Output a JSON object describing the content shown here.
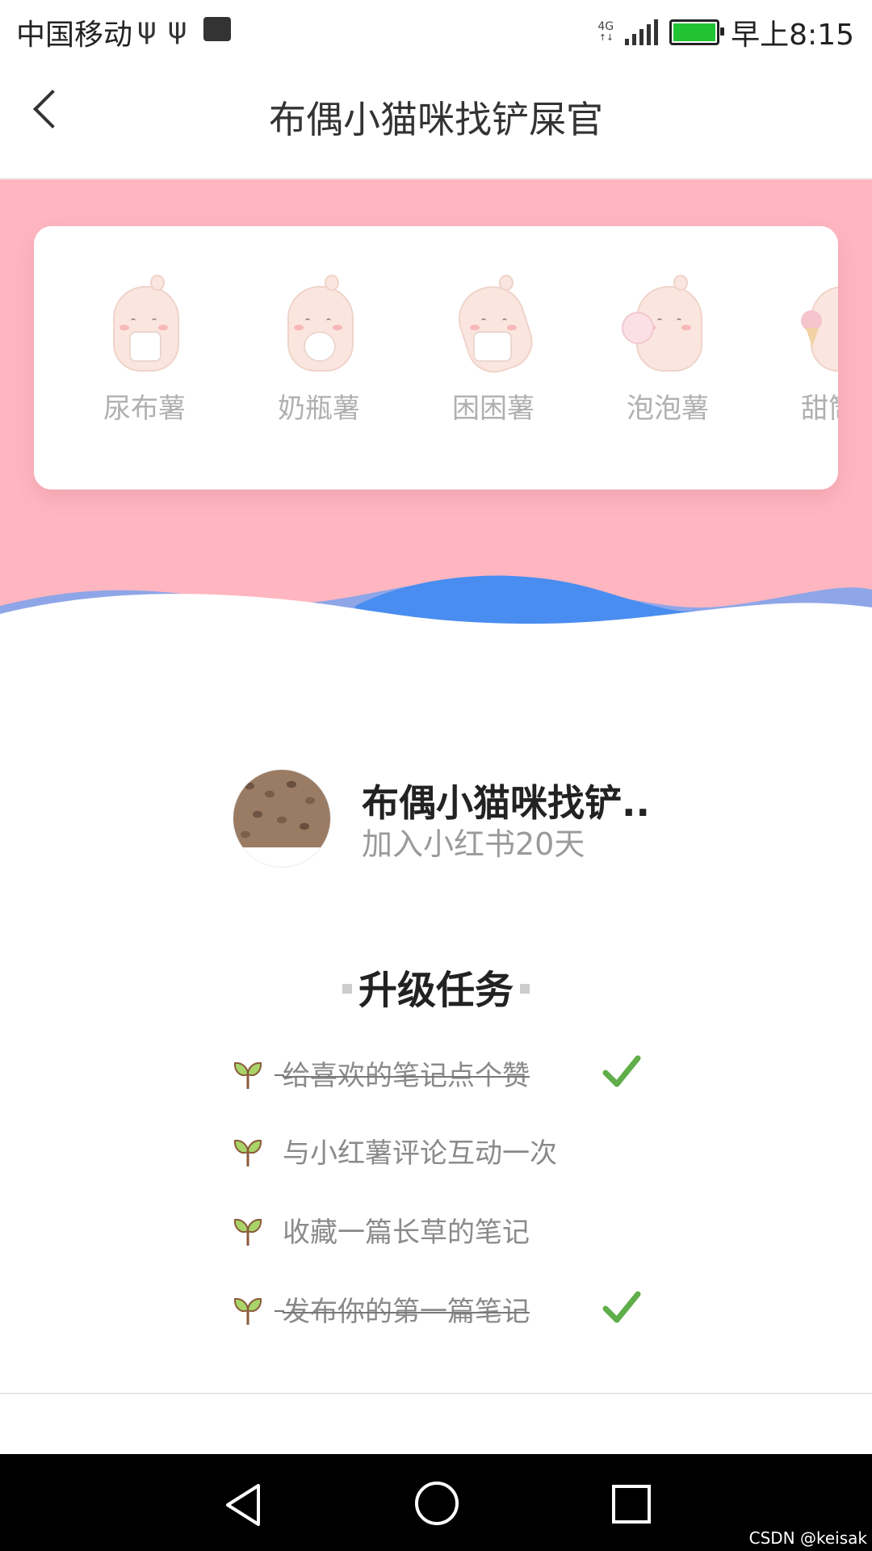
{
  "status_bar": {
    "carrier": "中国移动",
    "usb_icons": [
      "ψ",
      "ψ"
    ],
    "network": "4G",
    "time": "早上8:15",
    "battery_color": "#22c332"
  },
  "header": {
    "title": "布偶小猫咪找铲屎官"
  },
  "banner": {
    "background": "#ffb6c0",
    "levels": [
      {
        "label": "尿布薯",
        "icon": "diaper-potato-icon"
      },
      {
        "label": "奶瓶薯",
        "icon": "bottle-potato-icon"
      },
      {
        "label": "困困薯",
        "icon": "sleepy-potato-icon"
      },
      {
        "label": "泡泡薯",
        "icon": "bubble-potato-icon"
      },
      {
        "label": "甜筒薯",
        "icon": "icecream-potato-icon"
      }
    ]
  },
  "profile": {
    "name": "布偶小猫咪找铲..",
    "joined": "加入小红书20天"
  },
  "tasks": {
    "title": "升级任务",
    "items": [
      {
        "label": "给喜欢的笔记点个赞",
        "done": true
      },
      {
        "label": "与小红薯评论互动一次",
        "done": false
      },
      {
        "label": "收藏一篇长草的笔记",
        "done": false
      },
      {
        "label": "发布你的第一篇笔记",
        "done": true
      }
    ],
    "check_color": "#5fae4a"
  },
  "watermark": "CSDN @keisak"
}
